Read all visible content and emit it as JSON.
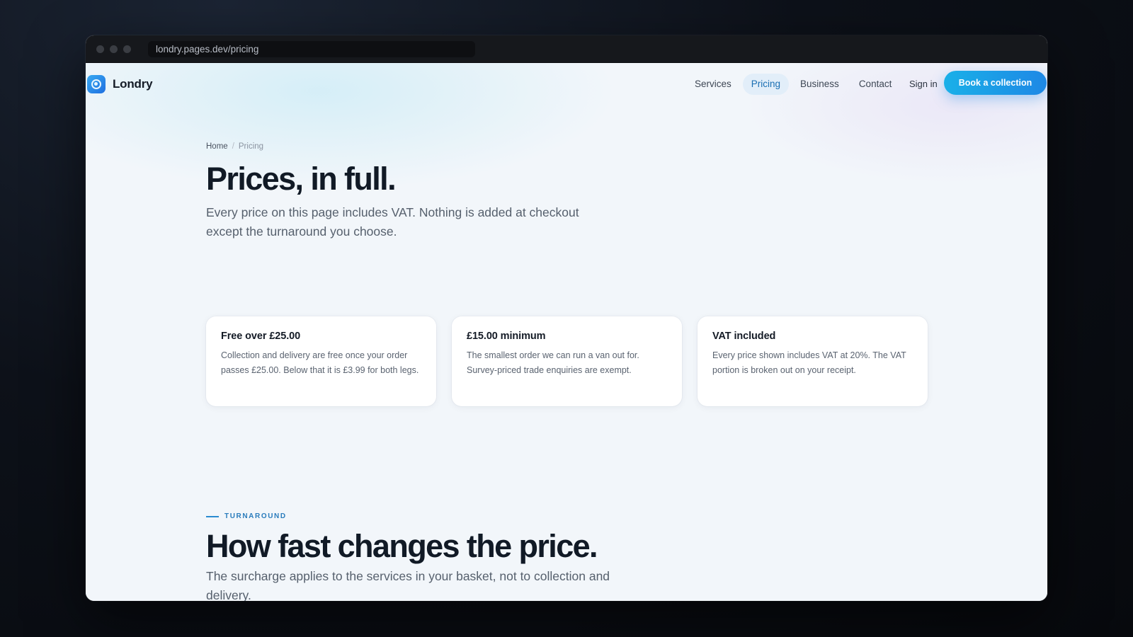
{
  "browser": {
    "url": "londry.pages.dev/pricing"
  },
  "nav": {
    "brand": "Londry",
    "links": [
      {
        "label": "Services",
        "active": false
      },
      {
        "label": "Pricing",
        "active": true
      },
      {
        "label": "Business",
        "active": false
      },
      {
        "label": "Contact",
        "active": false
      }
    ],
    "sign_in": "Sign in",
    "cta": "Book a collection"
  },
  "breadcrumb": {
    "home": "Home",
    "separator": "/",
    "current": "Pricing"
  },
  "hero": {
    "title": "Prices, in full.",
    "lede": "Every price on this page includes VAT. Nothing is added at checkout except the turnaround you choose."
  },
  "cards": [
    {
      "title": "Free over £25.00",
      "text": "Collection and delivery are free once your order passes £25.00. Below that it is £3.99 for both legs."
    },
    {
      "title": "£15.00 minimum",
      "text": "The smallest order we can run a van out for. Survey-priced trade enquiries are exempt."
    },
    {
      "title": "VAT included",
      "text": "Every price shown includes VAT at 20%. The VAT portion is broken out on your receipt."
    }
  ],
  "turnaround": {
    "eyebrow": "TURNAROUND",
    "title": "How fast changes the price.",
    "subtitle": "The surcharge applies to the services in your basket, not to collection and delivery."
  },
  "colors": {
    "accent": "#1e88e5",
    "active_nav_bg": "#e2eef9",
    "heading": "#111a26"
  }
}
